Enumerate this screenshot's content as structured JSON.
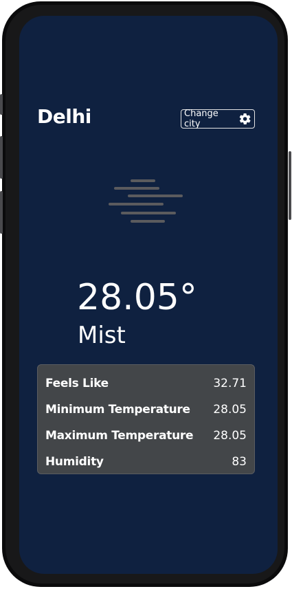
{
  "header": {
    "city": "Delhi",
    "change_city_label": "Change city"
  },
  "weather": {
    "icon": "mist-icon",
    "temperature": "28.05°",
    "condition": "Mist"
  },
  "details": [
    {
      "label": "Feels Like",
      "value": "32.71"
    },
    {
      "label": "Minimum Temperature",
      "value": "28.05"
    },
    {
      "label": "Maximum Temperature",
      "value": "28.05"
    },
    {
      "label": "Humidity",
      "value": "83"
    }
  ],
  "colors": {
    "background": "#0f2140",
    "card": "#434649",
    "mist_lines": "#5b5b5e"
  }
}
